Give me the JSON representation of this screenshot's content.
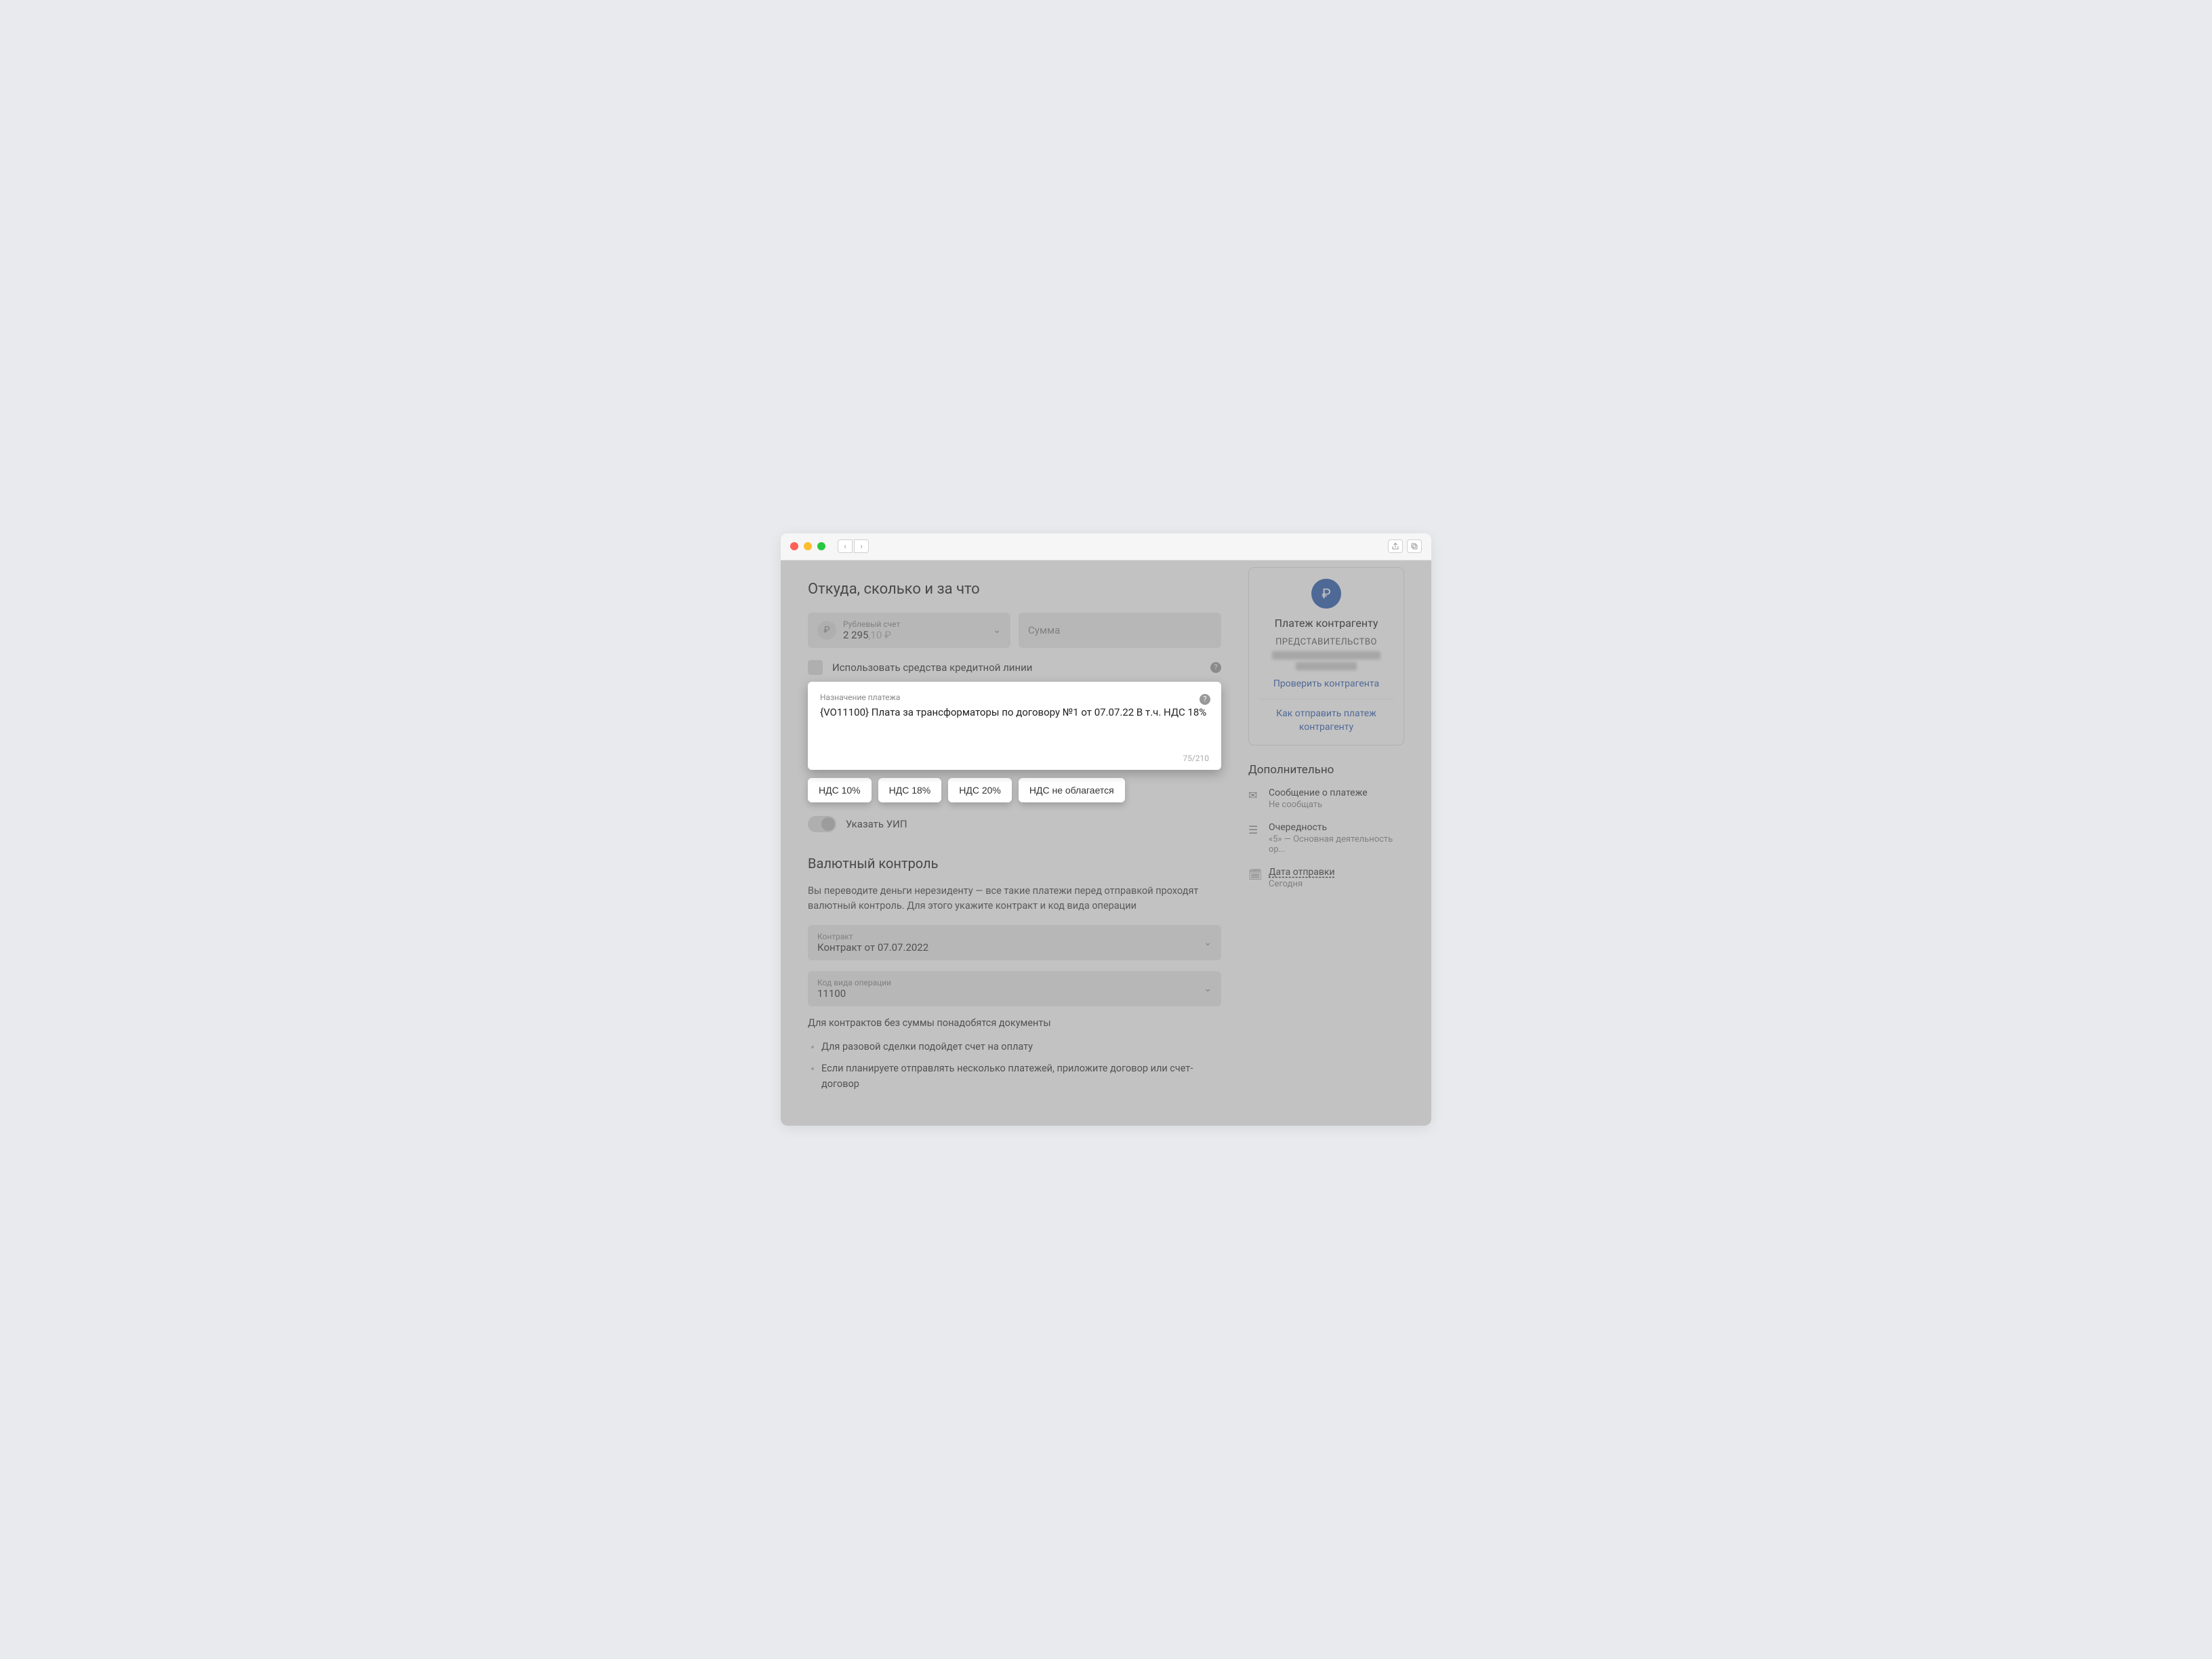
{
  "header": {
    "title": "Откуда, сколько и за что"
  },
  "account": {
    "label": "Рублевый счет",
    "balance_main": "2 295",
    "balance_cents": ",10 ₽"
  },
  "amount": {
    "placeholder": "Сумма"
  },
  "credit_line": {
    "label": "Использовать средства кредитной линии"
  },
  "purpose": {
    "label": "Назначение платежа",
    "text": "{VO11100} Плата за трансформаторы по договору №1 от 07.07.22 В т.ч. НДС 18%",
    "counter": "75/210"
  },
  "vat": {
    "opt10": "НДС 10%",
    "opt18": "НДС 18%",
    "opt20": "НДС 20%",
    "opt_none": "НДС не облагается"
  },
  "uip": {
    "label": "Указать УИП"
  },
  "currency": {
    "title": "Валютный контроль",
    "desc": "Вы переводите деньги нерезиденту — все такие платежи перед отправкой проходят валютный контроль. Для этого укажите контракт и код вида операции",
    "contract_label": "Контракт",
    "contract_value": "Контракт от 07.07.2022",
    "opcode_label": "Код вида операции",
    "opcode_value": "11100",
    "docs_note": "Для контрактов без суммы понадобятся документы",
    "bullet1": "Для разовой сделки подойдет счет на оплату",
    "bullet2": "Если планируете отправлять несколько платежей, приложите договор или счет-договор"
  },
  "sidebar": {
    "title": "Платеж контрагенту",
    "subtitle": "ПРЕДСТАВИТЕЛЬСТВО",
    "check_link": "Проверить контрагента",
    "howto_link": "Как отправить платеж контрагенту",
    "section": "Дополнительно",
    "msg_title": "Сообщение о платеже",
    "msg_sub": "Не сообщать",
    "order_title": "Очередность",
    "order_sub": "«5» — Основная деятельность ор...",
    "date_title": "Дата отправки",
    "date_sub": "Сегодня"
  }
}
